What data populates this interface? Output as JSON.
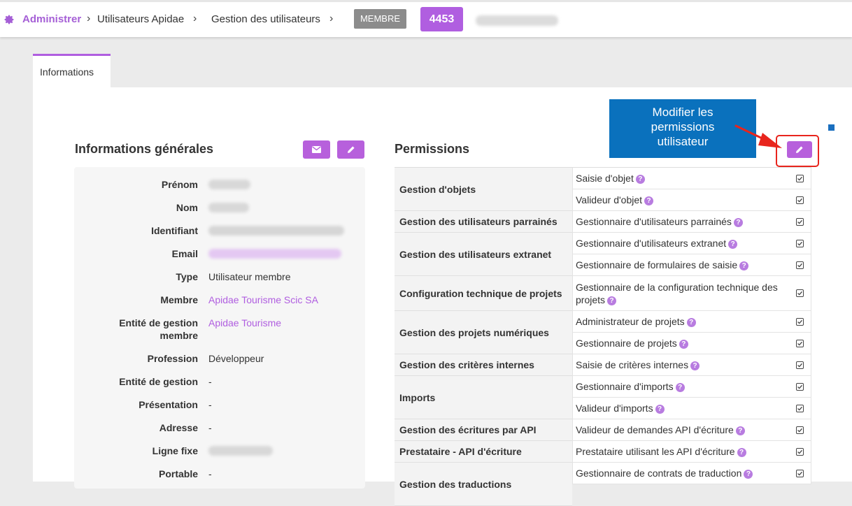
{
  "breadcrumb": {
    "admin": "Administrer",
    "item1": "Utilisateurs Apidae",
    "item2": "Gestion des utilisateurs",
    "badge_role": "MEMBRE",
    "badge_id": "4453"
  },
  "tabs": [
    {
      "label": "Informations"
    }
  ],
  "general": {
    "title": "Informations générales",
    "fields": [
      {
        "label": "Prénom",
        "value": ""
      },
      {
        "label": "Nom",
        "value": ""
      },
      {
        "label": "Identifiant",
        "value": ""
      },
      {
        "label": "Email",
        "value": ""
      },
      {
        "label": "Type",
        "value": "Utilisateur membre"
      },
      {
        "label": "Membre",
        "value": "Apidae Tourisme Scic SA"
      },
      {
        "label": "Entité de gestion membre",
        "value": "Apidae Tourisme"
      },
      {
        "label": "Profession",
        "value": "Développeur"
      },
      {
        "label": "Entité de gestion",
        "value": "-"
      },
      {
        "label": "Présentation",
        "value": "-"
      },
      {
        "label": "Adresse",
        "value": "-"
      },
      {
        "label": "Ligne fixe",
        "value": ""
      },
      {
        "label": "Portable",
        "value": "-"
      }
    ]
  },
  "permissions": {
    "title": "Permissions",
    "groups": [
      "Gestion d'objets",
      "Gestion des utilisateurs parrainés",
      "Gestion des utilisateurs extranet",
      "Configuration technique de projets",
      "Gestion des projets numériques",
      "Gestion des critères internes",
      "Imports",
      "Gestion des écritures par API",
      "Prestataire - API d'écriture",
      "Gestion des traductions"
    ],
    "rows": [
      "Saisie d'objet",
      "Valideur d'objet",
      "Gestionnaire d'utilisateurs parrainés",
      "Gestionnaire d'utilisateurs extranet",
      "Gestionnaire de formulaires de saisie",
      "Gestionnaire de la configuration technique des projets",
      "Administrateur de projets",
      "Gestionnaire de projets",
      "Saisie de critères internes",
      "Gestionnaire d'imports",
      "Valideur d'imports",
      "Valideur de demandes API d'écriture",
      "Prestataire utilisant les API d'écriture",
      "Gestionnaire de contrats de traduction"
    ],
    "checked": true
  },
  "callout": {
    "line1": "Modifier les",
    "line2": "permissions",
    "line3": "utilisateur"
  },
  "colors": {
    "accent": "#b05ee0",
    "badge_grey": "#8c8c8c",
    "callout_blue": "#0a71bd",
    "highlight_red": "#e8251d"
  }
}
